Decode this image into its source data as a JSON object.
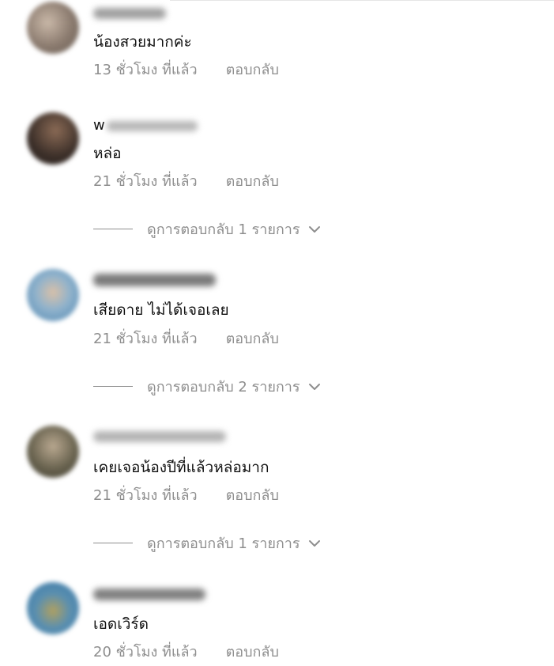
{
  "colors": {
    "text": "#111111",
    "secondary": "#8e8e8e",
    "background": "#ffffff"
  },
  "reply_label": "ตอบกลับ",
  "comments": [
    {
      "username": "ชุนญ",
      "username_visible": "",
      "text": "น้องสวยมากค่ะ",
      "time": "13 ชั่วโมง ที่แล้ว",
      "avatar_color": "#8a7a6e"
    },
    {
      "username": "w",
      "username_visible": "w",
      "text": "หล่อ",
      "time": "21 ชั่วโมง ที่แล้ว",
      "avatar_color": "#5a4a40",
      "view_replies": "ดูการตอบกลับ 1 รายการ"
    },
    {
      "username": "WENDERLAND",
      "username_visible": "",
      "text": "เสียดาย ไม่ได้เจอเลย",
      "time": "21 ชั่วโมง ที่แล้ว",
      "avatar_color": "#6b97b8",
      "view_replies": "ดูการตอบกลับ 2 รายการ"
    },
    {
      "username": "user4",
      "username_visible": "",
      "text": "เคยเจอน้องปีที่แล้วหล่อมาก",
      "time": "21 ชั่วโมง ที่แล้ว",
      "avatar_color": "#5e5a48",
      "view_replies": "ดูการตอบกลับ 1 รายการ"
    },
    {
      "username": "user5",
      "username_visible": "",
      "text": "เอดเวิร์ด",
      "time": "20 ชั่วโมง ที่แล้ว",
      "avatar_color": "#4a82a8"
    }
  ]
}
